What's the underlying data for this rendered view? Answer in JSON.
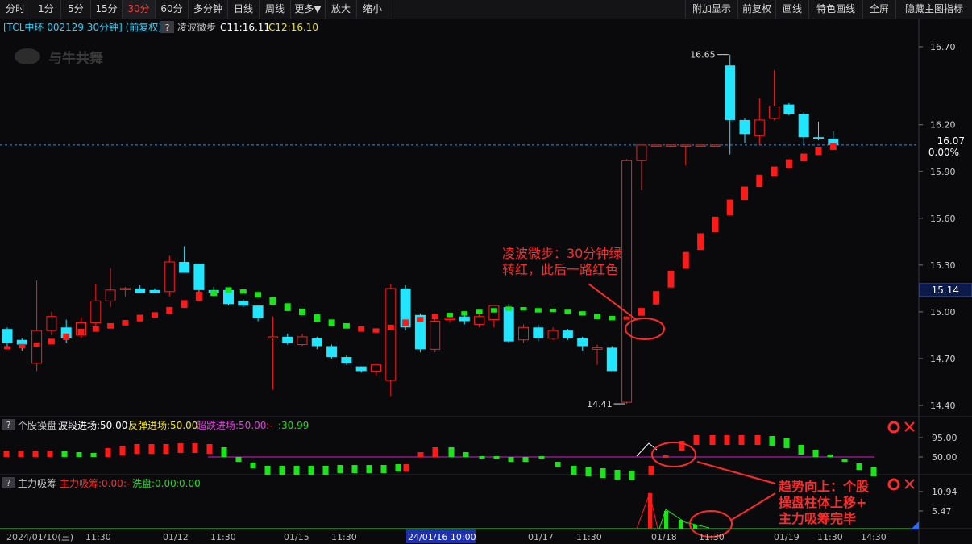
{
  "toolbar": {
    "left_tabs": [
      "分时",
      "1分",
      "5分",
      "15分",
      "30分",
      "60分",
      "多分钟",
      "日线",
      "周线",
      "更多▼",
      "放大",
      "缩小"
    ],
    "active_tab": "30分",
    "right_tabs": [
      "附加显示",
      "前复权",
      "画线",
      "特色画线",
      "全屏",
      "隐藏主图指标"
    ]
  },
  "header": {
    "title": "[TCL中环 002129 30分钟] (前复权)",
    "help_label": "?",
    "indicator_name": "凌波微步",
    "c11": "C11:16.11",
    "c12": "C12:16.10",
    "watermark": "与牛共舞"
  },
  "price_axis": {
    "ticks": [
      16.7,
      16.2,
      15.9,
      15.6,
      15.3,
      15.0,
      14.7,
      14.4
    ],
    "current_price": "16.07",
    "current_pct": "0.00%",
    "marker_price": "15.14"
  },
  "annotations": {
    "high_label": "16.65",
    "low_label": "14.41",
    "note1_line1": "凌波微步：30分钟绿",
    "note1_line2": "转红，此后一路红色",
    "note2_line1": "趋势向上：个股",
    "note2_line2": "操盘柱体上移+",
    "note2_line3": "主力吸筹完毕"
  },
  "panel2": {
    "help": "?",
    "name": "个股操盘",
    "s1": "波段进场:50.00",
    "s2": "反弹进场:50.00",
    "s3": "超跌进场:50.00",
    "s4": ":30.99",
    "ticks": [
      "95.00",
      "50.00"
    ]
  },
  "panel3": {
    "help": "?",
    "name": "主力吸筹",
    "s1": "主力吸筹:0.00",
    "s2": "洗盘:0.00",
    "s3": ":0.00",
    "ticks": [
      "10.94",
      "5.47"
    ]
  },
  "x_axis": {
    "labels": [
      "2024/01/10(三)",
      "11:30",
      "01/12",
      "11:30",
      "01/15",
      "11:30",
      "24/01/16 10:00",
      "01/17",
      "11:30",
      "01/18",
      "11:30",
      "01/19",
      "11:30",
      "14:30"
    ]
  },
  "colors": {
    "up": "#ff1a1a",
    "down": "#22e6ff",
    "green": "#19e619",
    "purple": "#d21ed2",
    "axis": "#3a3a40",
    "annotation": "#ff2a2a"
  },
  "chart_data": {
    "type": "candlestick",
    "title": "TCL中环 002129 30分钟 (前复权)",
    "candles": [
      {
        "o": 14.89,
        "c": 14.8,
        "h": 14.9,
        "l": 14.78
      },
      {
        "o": 14.82,
        "c": 14.79,
        "h": 14.83,
        "l": 14.75
      },
      {
        "o": 14.67,
        "c": 14.88,
        "h": 15.2,
        "l": 14.62
      },
      {
        "o": 14.88,
        "c": 14.97,
        "h": 15.0,
        "l": 14.85
      },
      {
        "o": 14.9,
        "c": 14.83,
        "h": 14.95,
        "l": 14.8
      },
      {
        "o": 14.85,
        "c": 14.93,
        "h": 14.97,
        "l": 14.83
      },
      {
        "o": 14.93,
        "c": 15.07,
        "h": 15.18,
        "l": 14.91
      },
      {
        "o": 15.07,
        "c": 15.14,
        "h": 15.28,
        "l": 15.03
      },
      {
        "o": 15.15,
        "c": 15.15,
        "h": 15.16,
        "l": 15.1
      },
      {
        "o": 15.15,
        "c": 15.12,
        "h": 15.17,
        "l": 15.12
      },
      {
        "o": 15.14,
        "c": 15.12,
        "h": 15.15,
        "l": 15.12
      },
      {
        "o": 15.13,
        "c": 15.32,
        "h": 15.36,
        "l": 15.1
      },
      {
        "o": 15.32,
        "c": 15.25,
        "h": 15.42,
        "l": 15.25
      },
      {
        "o": 15.31,
        "c": 15.14,
        "h": 15.31,
        "l": 15.12
      },
      {
        "o": 15.14,
        "c": 15.12,
        "h": 15.16,
        "l": 15.1
      },
      {
        "o": 15.14,
        "c": 15.05,
        "h": 15.15,
        "l": 15.04
      },
      {
        "o": 15.07,
        "c": 15.04,
        "h": 15.08,
        "l": 15.03
      },
      {
        "o": 15.04,
        "c": 14.96,
        "h": 15.04,
        "l": 14.94
      },
      {
        "o": 14.84,
        "c": 14.84,
        "h": 14.97,
        "l": 14.5
      },
      {
        "o": 14.84,
        "c": 14.8,
        "h": 14.86,
        "l": 14.79
      },
      {
        "o": 14.79,
        "c": 14.84,
        "h": 14.86,
        "l": 14.78
      },
      {
        "o": 14.83,
        "c": 14.78,
        "h": 14.84,
        "l": 14.76
      },
      {
        "o": 14.78,
        "c": 14.71,
        "h": 14.79,
        "l": 14.7
      },
      {
        "o": 14.71,
        "c": 14.67,
        "h": 14.72,
        "l": 14.66
      },
      {
        "o": 14.65,
        "c": 14.62,
        "h": 14.65,
        "l": 14.61
      },
      {
        "o": 14.62,
        "c": 14.66,
        "h": 14.67,
        "l": 14.59
      },
      {
        "o": 14.56,
        "c": 15.15,
        "h": 15.18,
        "l": 14.46
      },
      {
        "o": 15.15,
        "c": 14.9,
        "h": 15.17,
        "l": 14.88
      },
      {
        "o": 14.98,
        "c": 14.76,
        "h": 14.99,
        "l": 14.74
      },
      {
        "o": 14.76,
        "c": 14.94,
        "h": 14.99,
        "l": 14.74
      },
      {
        "o": 14.95,
        "c": 14.96,
        "h": 14.99,
        "l": 14.93
      },
      {
        "o": 14.97,
        "c": 14.94,
        "h": 14.98,
        "l": 14.92
      },
      {
        "o": 14.92,
        "c": 14.97,
        "h": 15.0,
        "l": 14.9
      },
      {
        "o": 14.95,
        "c": 15.04,
        "h": 15.04,
        "l": 14.9
      },
      {
        "o": 15.03,
        "c": 14.81,
        "h": 15.05,
        "l": 14.8
      },
      {
        "o": 14.82,
        "c": 14.9,
        "h": 14.92,
        "l": 14.8
      },
      {
        "o": 14.9,
        "c": 14.83,
        "h": 14.92,
        "l": 14.81
      },
      {
        "o": 14.83,
        "c": 14.88,
        "h": 14.9,
        "l": 14.82
      },
      {
        "o": 14.88,
        "c": 14.83,
        "h": 14.89,
        "l": 14.82
      },
      {
        "o": 14.83,
        "c": 14.78,
        "h": 14.84,
        "l": 14.75
      },
      {
        "o": 14.76,
        "c": 14.77,
        "h": 14.79,
        "l": 14.66
      },
      {
        "o": 14.77,
        "c": 14.62,
        "h": 14.78,
        "l": 14.62
      },
      {
        "o": 14.42,
        "c": 15.97,
        "h": 15.98,
        "l": 14.41
      },
      {
        "o": 15.97,
        "c": 16.07,
        "h": 16.07,
        "l": 15.78
      },
      {
        "o": 16.07,
        "c": 16.07,
        "h": 16.07,
        "l": 16.07
      },
      {
        "o": 16.07,
        "c": 16.07,
        "h": 16.07,
        "l": 16.07
      },
      {
        "o": 16.07,
        "c": 16.07,
        "h": 16.07,
        "l": 15.94
      },
      {
        "o": 16.07,
        "c": 16.07,
        "h": 16.07,
        "l": 16.07
      },
      {
        "o": 16.07,
        "c": 16.07,
        "h": 16.07,
        "l": 16.07
      },
      {
        "o": 16.58,
        "c": 16.23,
        "h": 16.65,
        "l": 16.01
      },
      {
        "o": 16.23,
        "c": 16.14,
        "h": 16.24,
        "l": 16.08
      },
      {
        "o": 16.13,
        "c": 16.23,
        "h": 16.37,
        "l": 16.07
      },
      {
        "o": 16.24,
        "c": 16.32,
        "h": 16.55,
        "l": 16.23
      },
      {
        "o": 16.33,
        "c": 16.27,
        "h": 16.34,
        "l": 16.26
      },
      {
        "o": 16.27,
        "c": 16.12,
        "h": 16.28,
        "l": 16.07
      },
      {
        "o": 16.12,
        "c": 16.11,
        "h": 16.22,
        "l": 16.1
      },
      {
        "o": 16.11,
        "c": 16.07,
        "h": 16.16,
        "l": 16.06
      }
    ],
    "lingbo": {
      "values": [
        14.77,
        14.78,
        14.79,
        14.81,
        14.84,
        14.87,
        14.89,
        14.91,
        14.93,
        14.96,
        14.98,
        15.01,
        15.05,
        15.1,
        15.12,
        15.14,
        15.13,
        15.11,
        15.07,
        15.03,
        15.0,
        14.96,
        14.93,
        14.91,
        14.89,
        14.88,
        14.9,
        14.93,
        14.95,
        14.97,
        14.98,
        14.99,
        15.0,
        15.01,
        15.02,
        15.02,
        15.01,
        15.01,
        15.0,
        14.99,
        14.97,
        14.96,
        14.96,
        15.0,
        15.09,
        15.21,
        15.33,
        15.45,
        15.56,
        15.67,
        15.76,
        15.84,
        15.9,
        15.95,
        15.99,
        16.03,
        16.06
      ],
      "colors": [
        "r",
        "r",
        "r",
        "r",
        "r",
        "r",
        "r",
        "r",
        "r",
        "r",
        "r",
        "r",
        "r",
        "r",
        "g",
        "g",
        "g",
        "g",
        "g",
        "g",
        "g",
        "g",
        "g",
        "g",
        "r",
        "r",
        "r",
        "r",
        "r",
        "r",
        "g",
        "g",
        "g",
        "g",
        "g",
        "g",
        "g",
        "g",
        "g",
        "g",
        "g",
        "g",
        "r",
        "r",
        "r",
        "r",
        "r",
        "r",
        "r",
        "r",
        "r",
        "r",
        "r",
        "r",
        "r",
        "r",
        "r"
      ]
    },
    "ylim": [
      14.3,
      16.8
    ]
  }
}
